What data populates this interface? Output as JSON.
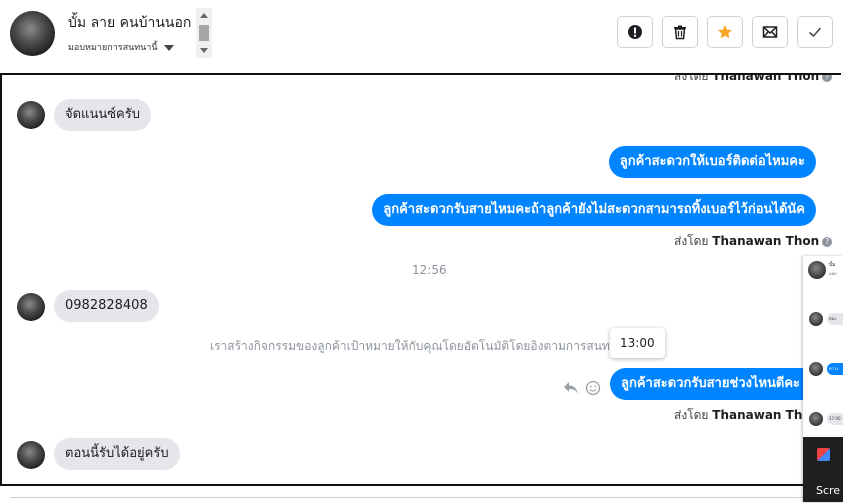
{
  "header": {
    "name": "บั้ม ลาย คนบ้านนอก",
    "subtitle": "มอบหมายการสนทนานี้",
    "actions": [
      {
        "icon": "alert-icon"
      },
      {
        "icon": "trash-icon"
      },
      {
        "icon": "star-icon",
        "color": "#f5a623"
      },
      {
        "icon": "mail-off-icon"
      },
      {
        "icon": "check-icon"
      }
    ]
  },
  "chat": {
    "top_sent_by": {
      "prefix": "ส่งโดย",
      "name": "Thanawan Thon"
    },
    "messages": [
      {
        "side": "in",
        "text": "จัดแนนซ์ครับ"
      },
      {
        "side": "out",
        "text": "ลูกค้าสะดวกให้เบอร์ติดต่อไหมคะ"
      },
      {
        "side": "out",
        "text": "ลูกค้าสะดวกรับสายไหมคะถ้าลูกค้ายังไม่สะดวกสามารถทิ้งเบอร์ไว้ก่อนได้นัค"
      },
      {
        "side": "in",
        "text": "0982828408"
      },
      {
        "side": "out",
        "text": "ลูกค้าสะดวกรับสายช่วงไหนดีคะ"
      },
      {
        "side": "in",
        "text": "ตอนนี้รับได้อยู่ครับ"
      }
    ],
    "sent_by_1": {
      "prefix": "ส่งโดย",
      "name": "Thanawan Thon"
    },
    "timestamp": "12:56",
    "system_text": "เราสร้างกิจกรรมของลูกค้าเป้าหมายให้กับคุณโดยอัตโนมัติโดยอิงตามการสนทน",
    "tooltip": "13:00",
    "sent_by_2": {
      "prefix": "ส่งโดย",
      "name": "Thanawan Thon"
    }
  },
  "side_panel": {
    "top_name": "บั้ม",
    "top_sub": "มอบ",
    "items": [
      {
        "text": "ต่อง"
      },
      {
        "text": "ค่าวร"
      },
      {
        "text": "17:00"
      }
    ],
    "taskbar_label": "Scre"
  }
}
